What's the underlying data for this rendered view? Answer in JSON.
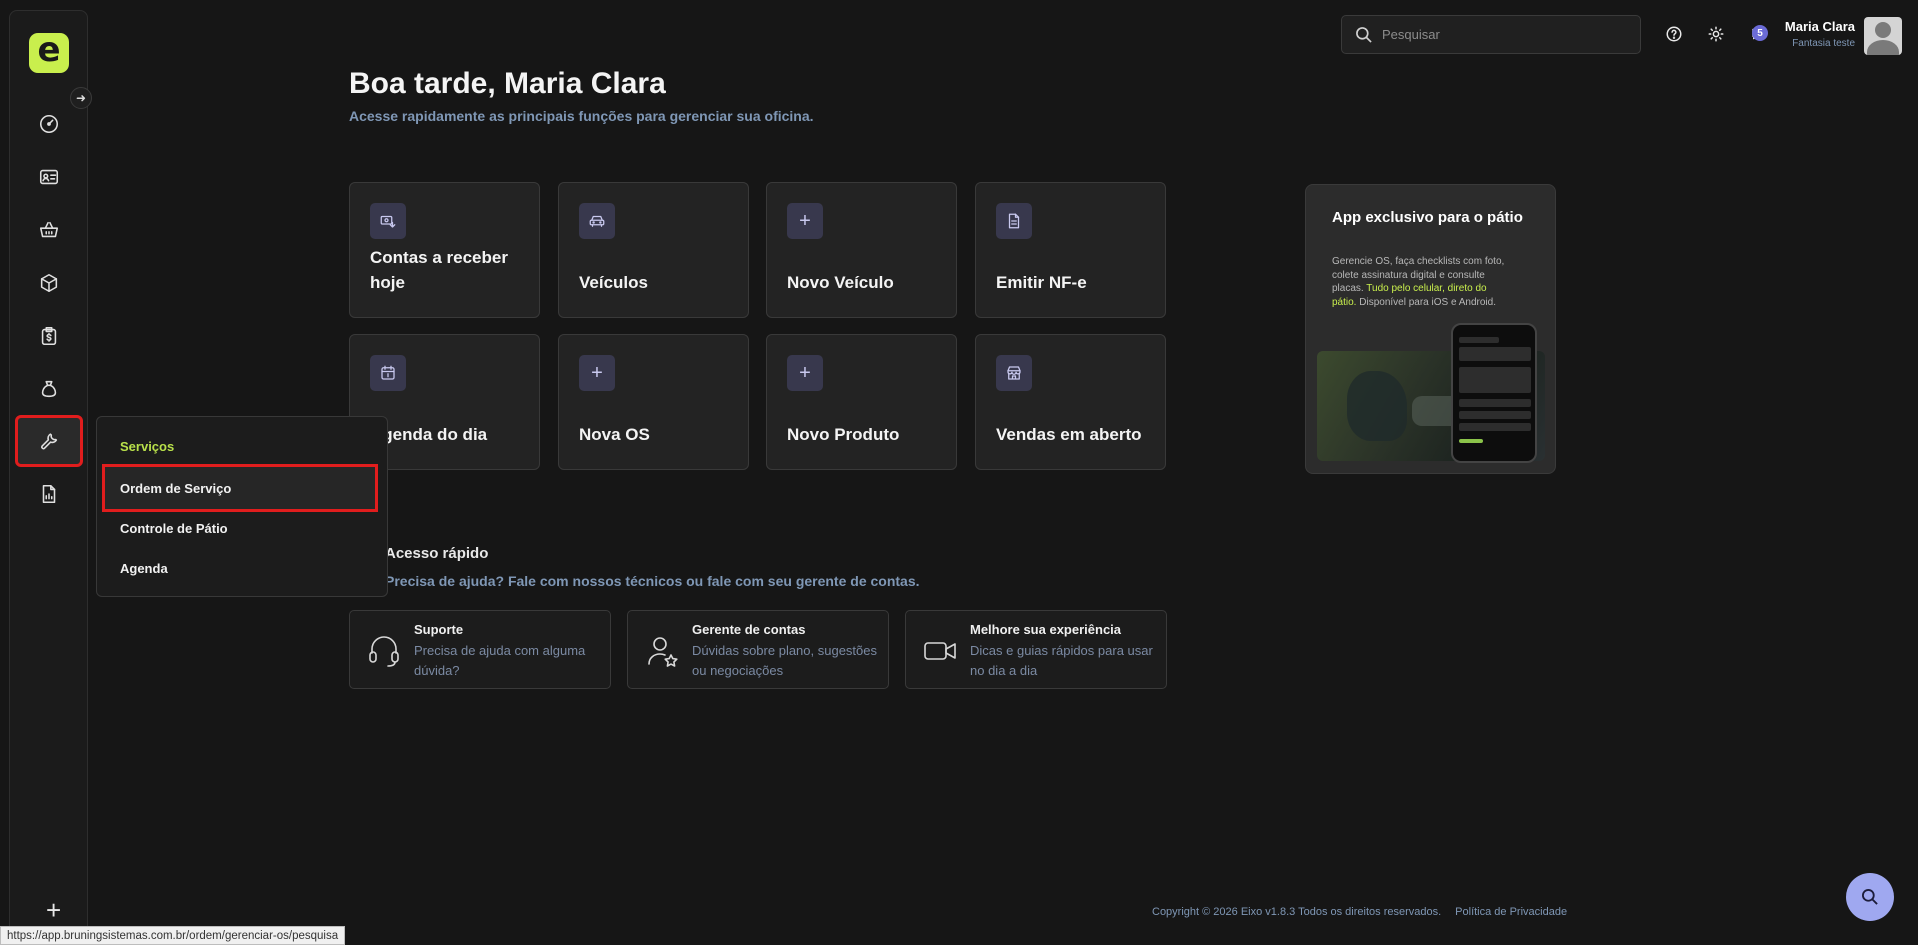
{
  "header": {
    "search_placeholder": "Pesquisar",
    "notification_count": "5",
    "user_name": "Maria Clara",
    "user_company": "Fantasia teste"
  },
  "sidebar": {
    "logo_letter": "e",
    "collapse_icon": "arrow-right-icon",
    "items": [
      {
        "name": "dashboard",
        "icon": "speedometer-icon"
      },
      {
        "name": "clientes",
        "icon": "id-card-icon"
      },
      {
        "name": "vendas",
        "icon": "basket-icon"
      },
      {
        "name": "produtos",
        "icon": "box-icon"
      },
      {
        "name": "financeiro",
        "icon": "clipboard-dollar-icon"
      },
      {
        "name": "caixa",
        "icon": "money-bag-icon"
      },
      {
        "name": "servicos",
        "icon": "wrench-icon",
        "active": true
      },
      {
        "name": "relatorios",
        "icon": "report-chart-icon"
      }
    ],
    "add_icon": "plus-icon"
  },
  "flyout": {
    "title": "Serviços",
    "items": [
      "Ordem de Serviço",
      "Controle de Pátio",
      "Agenda"
    ],
    "selected": "Ordem de Serviço"
  },
  "main": {
    "greeting": "Boa tarde, Maria Clara",
    "subtitle": "Acesse rapidamente as principais funções para gerenciar sua oficina.",
    "cards": [
      {
        "label": "Contas a receber hoje",
        "icon": "money-receive-icon"
      },
      {
        "label": "Veículos",
        "icon": "car-icon"
      },
      {
        "label": "Novo Veículo",
        "icon": "plus-icon"
      },
      {
        "label": "Emitir NF-e",
        "icon": "document-icon"
      },
      {
        "label": "Agenda do dia",
        "icon": "calendar-icon"
      },
      {
        "label": "Nova OS",
        "icon": "plus-icon"
      },
      {
        "label": "Novo Produto",
        "icon": "plus-icon"
      },
      {
        "label": "Vendas em aberto",
        "icon": "store-icon"
      }
    ]
  },
  "promo": {
    "title": "App exclusivo para o pátio",
    "desc_prefix": "Gerencie OS, faça checklists com foto, colete assinatura digital e consulte placas. ",
    "desc_highlight": "Tudo pelo celular, direto do pátio.",
    "desc_suffix": " Disponível para iOS e Android."
  },
  "quick": {
    "title": "Acesso rápido",
    "subtitle": "Precisa de ajuda? Fale com nossos técnicos ou fale com seu gerente de contas.",
    "cards": [
      {
        "title": "Suporte",
        "desc": "Precisa de ajuda com alguma dúvida?",
        "icon": "headset-icon"
      },
      {
        "title": "Gerente de contas",
        "desc": "Dúvidas sobre plano, sugestões ou negociações",
        "icon": "user-star-icon"
      },
      {
        "title": "Melhore sua experiência",
        "desc": "Dicas e guias rápidos para usar no dia a dia",
        "icon": "video-camera-icon"
      }
    ]
  },
  "footer": {
    "copyright": "Copyright © 2026 Eixo v1.8.3 Todos os direitos reservados.",
    "privacy": "Política de Privacidade"
  },
  "statusbar": {
    "url": "https://app.bruningsistemas.com.br/ordem/gerenciar-os/pesquisa"
  },
  "colors": {
    "accent": "#c9ef4d",
    "highlight_outline": "#e11d1d",
    "muted_blue": "#7f97b5"
  }
}
